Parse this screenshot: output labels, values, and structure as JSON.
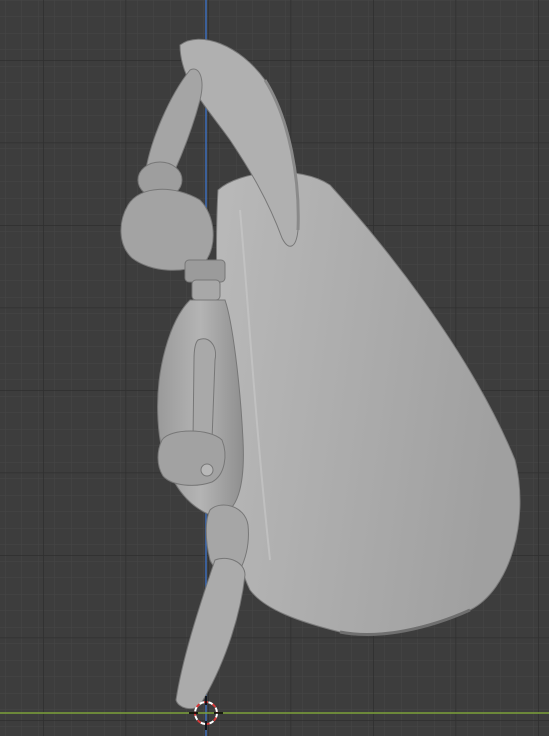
{
  "viewport": {
    "background": "#3d3d3d",
    "grid_minor_color": "#474747",
    "grid_major_color": "#2f2f2f",
    "x_axis_color": "#7da13a",
    "z_axis_color": "#3c6cb8",
    "model_fill": "#a9a9a9",
    "model_shade": "#8e8e8e",
    "model_highlight": "#c4c4c4"
  },
  "scene": {
    "object": "character-mesh",
    "cursor_icon": "3d-cursor-icon"
  }
}
